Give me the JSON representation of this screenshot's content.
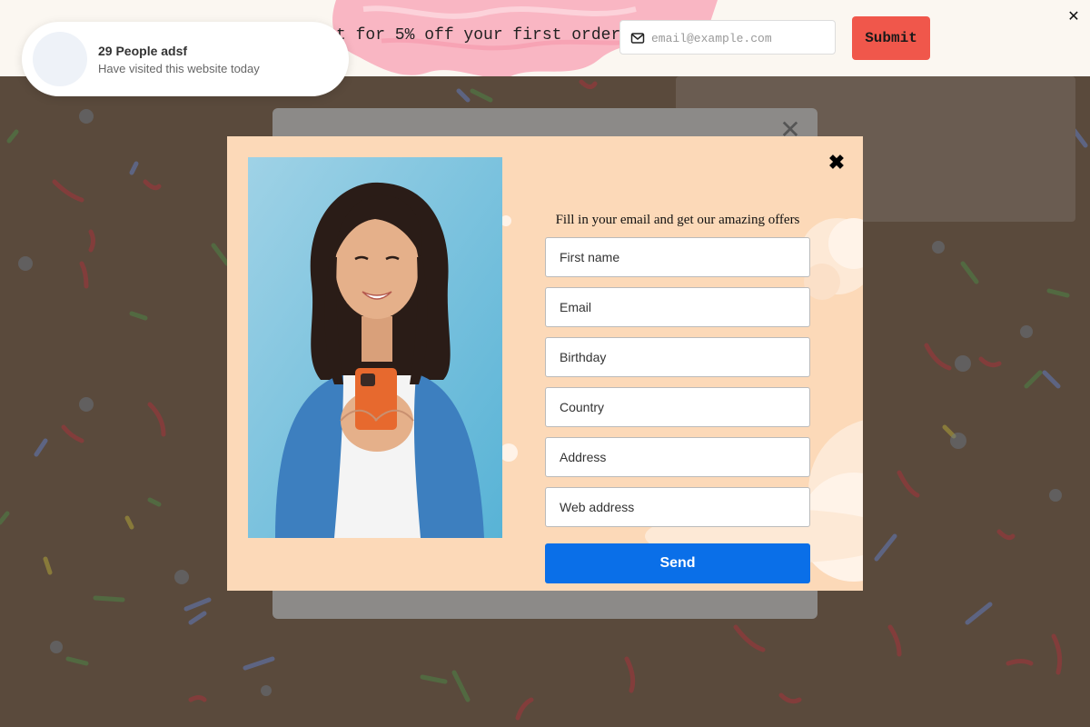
{
  "top_bar": {
    "promo_text": "t for 5% off your first order",
    "email_placeholder": "email@example.com",
    "submit_label": "Submit",
    "close_label": "✕"
  },
  "social_proof": {
    "title": "29 People adsf",
    "subtitle": "Have visited this website today"
  },
  "background_modal": {
    "close_label": "✕"
  },
  "modal": {
    "close_label": "✖",
    "form_title": "Fill in your email and get our amazing offers",
    "fields": [
      {
        "placeholder": "First name"
      },
      {
        "placeholder": "Email"
      },
      {
        "placeholder": "Birthday"
      },
      {
        "placeholder": "Country"
      },
      {
        "placeholder": "Address"
      },
      {
        "placeholder": "Web address"
      }
    ],
    "send_label": "Send"
  },
  "colors": {
    "page_backdrop": "#5a4a3c",
    "modal_bg": "#fcd9b8",
    "submit_bg": "#f0574b",
    "send_bg": "#0a6fe8",
    "brush_pink": "#f9b6c3"
  },
  "icons": {
    "email_input_icon": "mail-icon",
    "top_bar_close": "close-icon",
    "modal_close": "close-icon",
    "photo": "woman-with-phone-photo"
  }
}
